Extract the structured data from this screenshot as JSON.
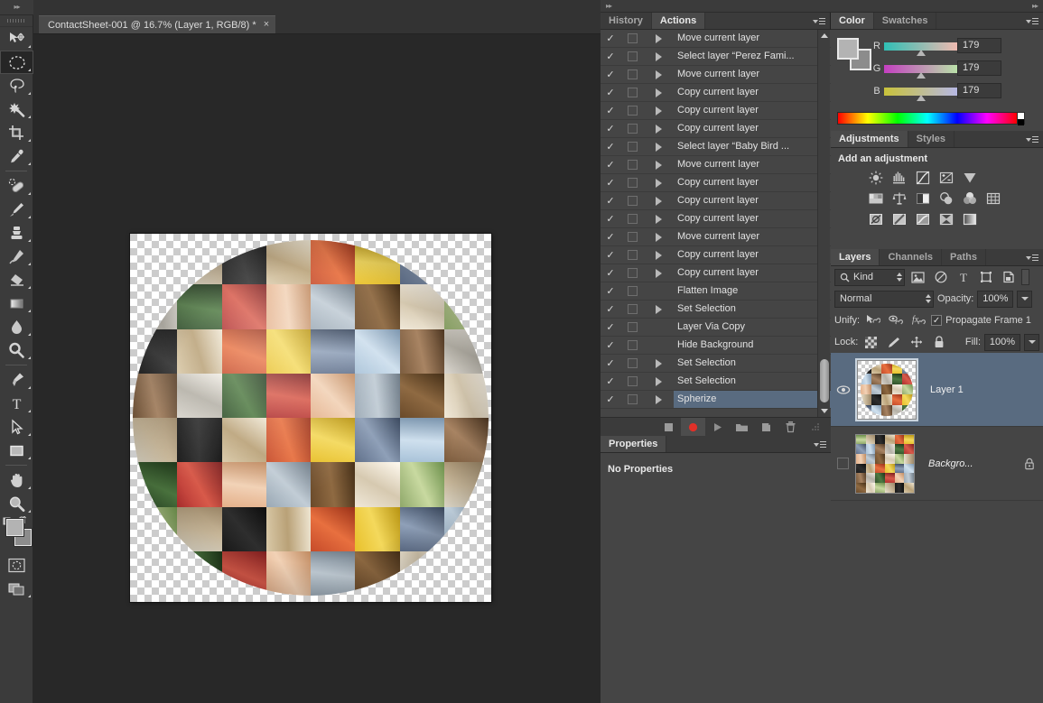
{
  "app": {
    "document_tab": "ContactSheet-001 @ 16.7% (Layer 1, RGB/8) *",
    "close_glyph": "×",
    "collapse_glyph": "▸▸"
  },
  "toolbar": {
    "tools": [
      {
        "name": "move-tool",
        "label": "Move Tool",
        "selected": false
      },
      {
        "name": "elliptical-marquee-tool",
        "label": "Elliptical Marquee Tool",
        "selected": true
      },
      {
        "name": "lasso-tool",
        "label": "Lasso Tool",
        "selected": false
      },
      {
        "name": "magic-wand-tool",
        "label": "Magic Wand Tool",
        "selected": false
      },
      {
        "name": "crop-tool",
        "label": "Crop Tool",
        "selected": false
      },
      {
        "name": "eyedropper-tool",
        "label": "Eyedropper Tool",
        "selected": false
      },
      {
        "name": "spot-healing-brush-tool",
        "label": "Spot Healing Brush Tool",
        "selected": false
      },
      {
        "name": "brush-tool",
        "label": "Brush Tool",
        "selected": false
      },
      {
        "name": "clone-stamp-tool",
        "label": "Clone Stamp Tool",
        "selected": false
      },
      {
        "name": "history-brush-tool",
        "label": "History Brush Tool",
        "selected": false
      },
      {
        "name": "eraser-tool",
        "label": "Eraser Tool",
        "selected": false
      },
      {
        "name": "gradient-tool",
        "label": "Gradient Tool",
        "selected": false
      },
      {
        "name": "blur-tool",
        "label": "Blur Tool",
        "selected": false
      },
      {
        "name": "dodge-tool",
        "label": "Dodge Tool",
        "selected": false
      },
      {
        "name": "pen-tool",
        "label": "Pen Tool",
        "selected": false
      },
      {
        "name": "type-tool",
        "label": "Horizontal Type Tool",
        "selected": false
      },
      {
        "name": "path-selection-tool",
        "label": "Path Selection Tool",
        "selected": false
      },
      {
        "name": "rectangle-tool",
        "label": "Rectangle Tool",
        "selected": false
      },
      {
        "name": "hand-tool",
        "label": "Hand Tool",
        "selected": false
      },
      {
        "name": "zoom-tool",
        "label": "Zoom Tool",
        "selected": false
      }
    ],
    "foreground_color": "#b3b3b3",
    "background_color": "#8c8c8c",
    "quick_mask_label": "Edit in Quick Mask Mode",
    "screen_mode_label": "Change Screen Mode"
  },
  "actions_panel": {
    "tabs": [
      {
        "label": "History",
        "active": false
      },
      {
        "label": "Actions",
        "active": true
      }
    ],
    "items": [
      {
        "label": "Move current layer",
        "checked": true,
        "expandable": true,
        "selected": false
      },
      {
        "label": "Select layer “Perez Fami...",
        "checked": true,
        "expandable": true,
        "selected": false
      },
      {
        "label": "Move current layer",
        "checked": true,
        "expandable": true,
        "selected": false
      },
      {
        "label": "Copy current layer",
        "checked": true,
        "expandable": true,
        "selected": false
      },
      {
        "label": "Copy current layer",
        "checked": true,
        "expandable": true,
        "selected": false
      },
      {
        "label": "Copy current layer",
        "checked": true,
        "expandable": true,
        "selected": false
      },
      {
        "label": "Select layer “Baby Bird ...",
        "checked": true,
        "expandable": true,
        "selected": false
      },
      {
        "label": "Move current layer",
        "checked": true,
        "expandable": true,
        "selected": false
      },
      {
        "label": "Copy current layer",
        "checked": true,
        "expandable": true,
        "selected": false
      },
      {
        "label": "Copy current layer",
        "checked": true,
        "expandable": true,
        "selected": false
      },
      {
        "label": "Copy current layer",
        "checked": true,
        "expandable": true,
        "selected": false
      },
      {
        "label": "Move current layer",
        "checked": true,
        "expandable": true,
        "selected": false
      },
      {
        "label": "Copy current layer",
        "checked": true,
        "expandable": true,
        "selected": false
      },
      {
        "label": "Copy current layer",
        "checked": true,
        "expandable": true,
        "selected": false
      },
      {
        "label": "Flatten Image",
        "checked": true,
        "expandable": false,
        "selected": false
      },
      {
        "label": "Set Selection",
        "checked": true,
        "expandable": true,
        "selected": false
      },
      {
        "label": "Layer Via Copy",
        "checked": true,
        "expandable": false,
        "selected": false
      },
      {
        "label": "Hide Background",
        "checked": true,
        "expandable": false,
        "selected": false
      },
      {
        "label": "Set Selection",
        "checked": true,
        "expandable": true,
        "selected": false
      },
      {
        "label": "Set Selection",
        "checked": true,
        "expandable": true,
        "selected": false
      },
      {
        "label": "Spherize",
        "checked": true,
        "expandable": true,
        "selected": true
      }
    ],
    "footer_buttons": [
      {
        "name": "stop-button",
        "label": "Stop playing/recording"
      },
      {
        "name": "record-button",
        "label": "Begin recording"
      },
      {
        "name": "play-button",
        "label": "Play selection"
      },
      {
        "name": "new-set-button",
        "label": "Create new set"
      },
      {
        "name": "new-action-button",
        "label": "Create new action"
      },
      {
        "name": "delete-button",
        "label": "Delete"
      }
    ],
    "check_glyph": "✓"
  },
  "properties_panel": {
    "tab": "Properties",
    "empty_text": "No Properties"
  },
  "color_panel": {
    "tabs": [
      {
        "label": "Color",
        "active": true
      },
      {
        "label": "Swatches",
        "active": false
      }
    ],
    "channels": [
      {
        "label": "R",
        "value": "179"
      },
      {
        "label": "G",
        "value": "179"
      },
      {
        "label": "B",
        "value": "179"
      }
    ],
    "foreground_color": "#b3b3b3",
    "background_color": "#8c8c8c"
  },
  "adjustments_panel": {
    "tabs": [
      {
        "label": "Adjustments",
        "active": true
      },
      {
        "label": "Styles",
        "active": false
      }
    ],
    "title": "Add an adjustment",
    "rows": [
      [
        {
          "name": "brightness-contrast-icon",
          "label": "Brightness/Contrast"
        },
        {
          "name": "levels-icon",
          "label": "Levels"
        },
        {
          "name": "curves-icon",
          "label": "Curves"
        },
        {
          "name": "exposure-icon",
          "label": "Exposure"
        },
        {
          "name": "vibrance-icon",
          "label": "Vibrance"
        }
      ],
      [
        {
          "name": "hue-saturation-icon",
          "label": "Hue/Saturation"
        },
        {
          "name": "color-balance-icon",
          "label": "Color Balance"
        },
        {
          "name": "black-white-icon",
          "label": "Black & White"
        },
        {
          "name": "photo-filter-icon",
          "label": "Photo Filter"
        },
        {
          "name": "channel-mixer-icon",
          "label": "Channel Mixer"
        },
        {
          "name": "color-lookup-icon",
          "label": "Color Lookup"
        }
      ],
      [
        {
          "name": "invert-icon",
          "label": "Invert"
        },
        {
          "name": "posterize-icon",
          "label": "Posterize"
        },
        {
          "name": "threshold-icon",
          "label": "Threshold"
        },
        {
          "name": "selective-color-icon",
          "label": "Selective Color"
        },
        {
          "name": "gradient-map-icon",
          "label": "Gradient Map"
        }
      ]
    ]
  },
  "layers_panel": {
    "tabs": [
      {
        "label": "Layers",
        "active": true
      },
      {
        "label": "Channels",
        "active": false
      },
      {
        "label": "Paths",
        "active": false
      }
    ],
    "filter_kind": "Kind",
    "filter_icons": [
      {
        "name": "filter-pixel-icon",
        "label": "Filter for pixel layers"
      },
      {
        "name": "filter-adjustment-icon",
        "label": "Filter for adjustment layers"
      },
      {
        "name": "filter-type-icon",
        "label": "Filter for type layers"
      },
      {
        "name": "filter-shape-icon",
        "label": "Filter for shape layers"
      },
      {
        "name": "filter-smart-object-icon",
        "label": "Filter for smart objects"
      }
    ],
    "blend_mode": "Normal",
    "opacity_label": "Opacity:",
    "opacity_value": "100%",
    "unify_label": "Unify:",
    "unify_icons": [
      {
        "name": "unify-position-icon",
        "label": "Unify layer position"
      },
      {
        "name": "unify-visibility-icon",
        "label": "Unify layer visibility"
      },
      {
        "name": "unify-style-icon",
        "label": "Unify layer style"
      }
    ],
    "propagate_label": "Propagate Frame 1",
    "propagate_checked": true,
    "lock_label": "Lock:",
    "lock_icons": [
      {
        "name": "lock-transparent-pixels-icon",
        "label": "Lock transparent pixels"
      },
      {
        "name": "lock-image-pixels-icon",
        "label": "Lock image pixels"
      },
      {
        "name": "lock-position-icon",
        "label": "Lock position"
      },
      {
        "name": "lock-all-icon",
        "label": "Lock all"
      }
    ],
    "fill_label": "Fill:",
    "fill_value": "100%",
    "layers": [
      {
        "name": "Layer 1",
        "visible": true,
        "selected": true,
        "locked": false,
        "italic": false
      },
      {
        "name": "Backgro...",
        "visible": false,
        "selected": false,
        "locked": true,
        "italic": true
      }
    ],
    "selection_color": "#596b80"
  },
  "canvas": {
    "zoom_level": "16.7%",
    "background_color": "#282828",
    "artboard_label": "spherized-photo-collage"
  }
}
